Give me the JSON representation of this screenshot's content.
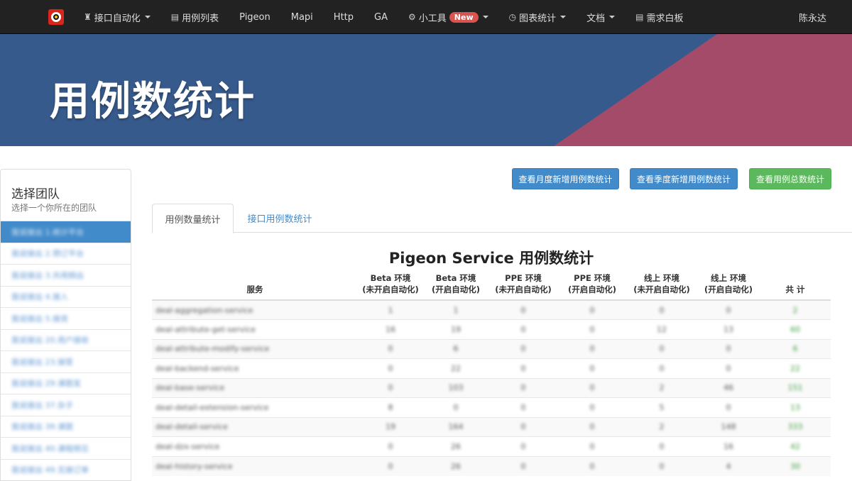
{
  "navbar": {
    "items": [
      {
        "label": "接口自动化",
        "icon": "robot-icon",
        "dropdown": true
      },
      {
        "label": "用例列表",
        "icon": "list-icon",
        "dropdown": false
      },
      {
        "label": "Pigeon",
        "icon": "",
        "dropdown": false
      },
      {
        "label": "Mapi",
        "icon": "",
        "dropdown": false
      },
      {
        "label": "Http",
        "icon": "",
        "dropdown": false
      },
      {
        "label": "GA",
        "icon": "",
        "dropdown": false
      },
      {
        "label": "小工具",
        "icon": "gear-icon",
        "dropdown": true,
        "badge": "New"
      },
      {
        "label": "图表统计",
        "icon": "clock-icon",
        "dropdown": true
      },
      {
        "label": "文档",
        "icon": "",
        "dropdown": true
      },
      {
        "label": "需求白板",
        "icon": "list-icon",
        "dropdown": false
      }
    ],
    "user": "陈永达"
  },
  "hero": {
    "title": "用例数统计",
    "colors": {
      "blue": "#375a8c",
      "pink": "#a34b68"
    }
  },
  "sidebar": {
    "title": "选择团队",
    "subtitle": "选择一个你所在的团队",
    "teams": [
      "我说接出 1.统计平台",
      "我说接出 2.预订平台",
      "我说接出 3.共用频出",
      "我说接出 4.接入",
      "我说接出 5.接资",
      "我说接出 20.用户接收",
      "我说接出 23.接受",
      "我说接出 29.课题发",
      "我说接出 37.杂子",
      "我说接出 39.课题",
      "我说接出 40.课程频见",
      "我说接出 49.无接订单"
    ]
  },
  "buttons": {
    "monthly": "查看月度新增用例数统计",
    "quarterly": "查看季度新增用例数统计",
    "total": "查看用例总数统计"
  },
  "tabs": {
    "case_count": "用例数量统计",
    "api_count": "接口用例数统计"
  },
  "table": {
    "title": "Pigeon Service 用例数统计",
    "headers": [
      {
        "line1": "",
        "line2": "服务"
      },
      {
        "line1": "Beta 环境",
        "line2": "(未开启自动化)"
      },
      {
        "line1": "Beta 环境",
        "line2": "(开启自动化)"
      },
      {
        "line1": "PPE 环境",
        "line2": "(未开启自动化)"
      },
      {
        "line1": "PPE 环境",
        "line2": "(开启自动化)"
      },
      {
        "line1": "线上 环境",
        "line2": "(未开启自动化)"
      },
      {
        "line1": "线上 环境",
        "line2": "(开启自动化)"
      },
      {
        "line1": "",
        "line2": "共 计"
      }
    ],
    "rows": [
      [
        "deal-aggregation-service",
        "1",
        "1",
        "0",
        "0",
        "0",
        "0",
        "2"
      ],
      [
        "deal-attribute-get-service",
        "16",
        "19",
        "0",
        "0",
        "12",
        "13",
        "60"
      ],
      [
        "deal-attribute-modify-service",
        "0",
        "6",
        "0",
        "0",
        "0",
        "0",
        "6"
      ],
      [
        "deal-backend-service",
        "0",
        "22",
        "0",
        "0",
        "0",
        "0",
        "22"
      ],
      [
        "deal-base-service",
        "0",
        "103",
        "0",
        "0",
        "2",
        "46",
        "151"
      ],
      [
        "deal-detail-extension-service",
        "8",
        "0",
        "0",
        "0",
        "5",
        "0",
        "13"
      ],
      [
        "deal-detail-service",
        "19",
        "164",
        "0",
        "0",
        "2",
        "148",
        "333"
      ],
      [
        "deal-dzx-service",
        "0",
        "26",
        "0",
        "0",
        "0",
        "16",
        "42"
      ],
      [
        "deal-history-service",
        "0",
        "26",
        "0",
        "0",
        "0",
        "4",
        "30"
      ]
    ]
  }
}
